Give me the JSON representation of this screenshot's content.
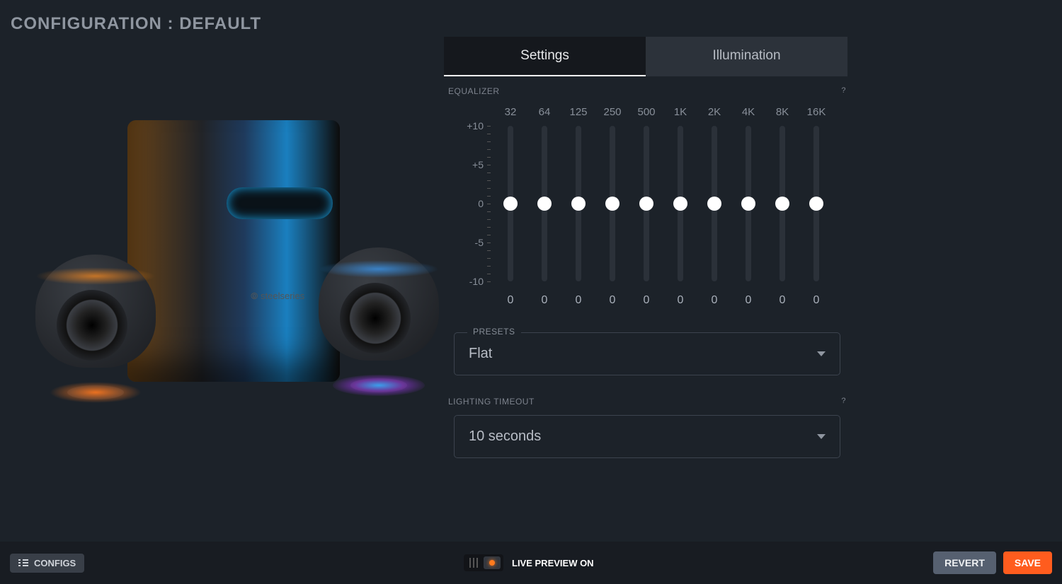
{
  "header": {
    "title": "CONFIGURATION : DEFAULT"
  },
  "tabs": {
    "settings": "Settings",
    "illumination": "Illumination"
  },
  "equalizer": {
    "label": "EQUALIZER",
    "help": "?",
    "scale": {
      "p10": "+10",
      "p5": "+5",
      "zero": "0",
      "m5": "-5",
      "m10": "-10"
    },
    "bands": [
      {
        "freq": "32",
        "value": "0"
      },
      {
        "freq": "64",
        "value": "0"
      },
      {
        "freq": "125",
        "value": "0"
      },
      {
        "freq": "250",
        "value": "0"
      },
      {
        "freq": "500",
        "value": "0"
      },
      {
        "freq": "1K",
        "value": "0"
      },
      {
        "freq": "2K",
        "value": "0"
      },
      {
        "freq": "4K",
        "value": "0"
      },
      {
        "freq": "8K",
        "value": "0"
      },
      {
        "freq": "16K",
        "value": "0"
      }
    ]
  },
  "presets": {
    "label": "PRESETS",
    "selected": "Flat"
  },
  "lighting_timeout": {
    "label": "LIGHTING TIMEOUT",
    "help": "?",
    "selected": "10 seconds"
  },
  "footer": {
    "configs": "CONFIGS",
    "live_preview": "LIVE PREVIEW ON",
    "revert": "REVERT",
    "save": "SAVE"
  }
}
